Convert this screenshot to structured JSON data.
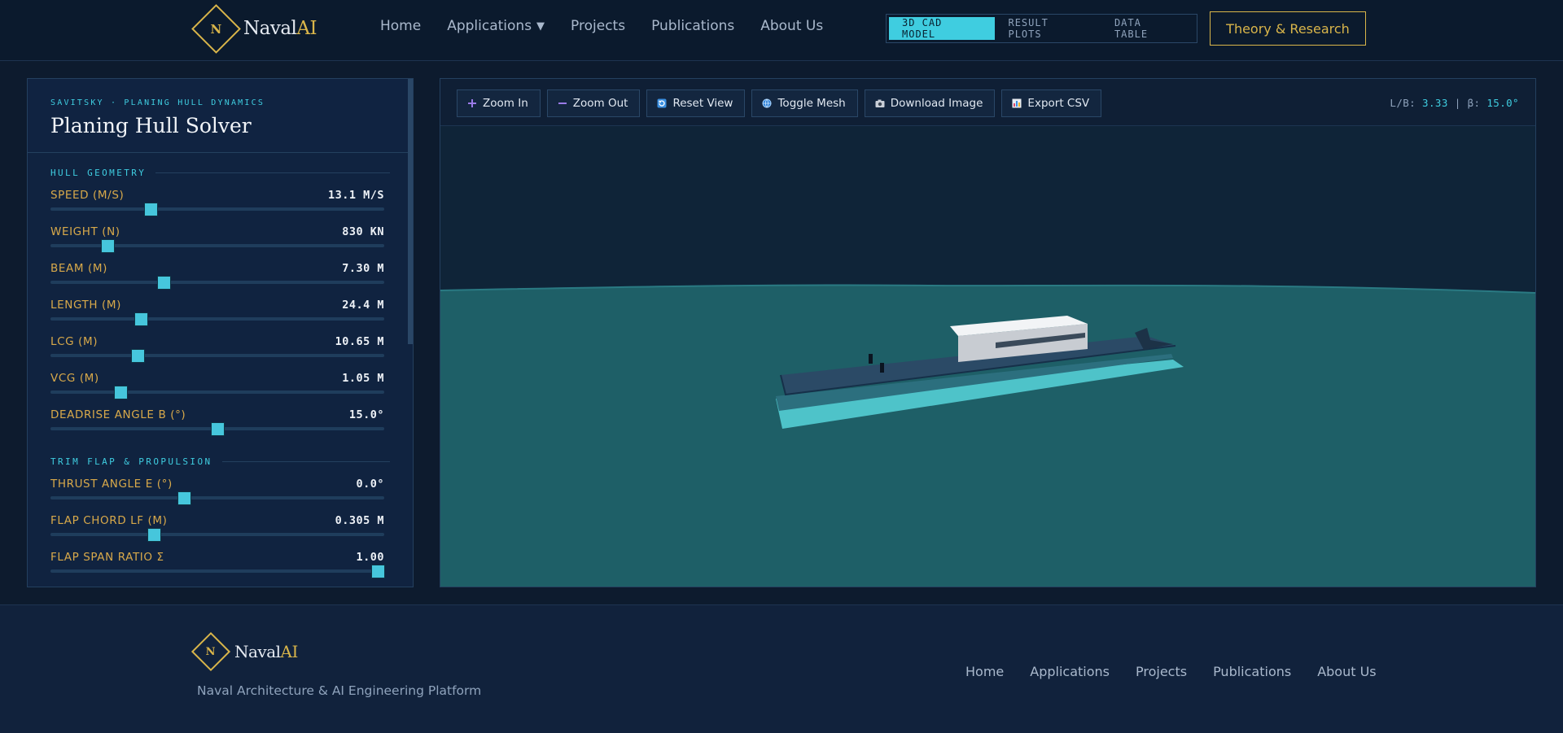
{
  "brand": {
    "initial": "N",
    "name_main": "Naval",
    "name_accent": "AI"
  },
  "nav": {
    "home": "Home",
    "applications": "Applications",
    "applications_caret": "▼",
    "projects": "Projects",
    "publications": "Publications",
    "about": "About Us"
  },
  "view_tabs": [
    {
      "label": "3D CAD MODEL",
      "active": true
    },
    {
      "label": "RESULT PLOTS",
      "active": false
    },
    {
      "label": "DATA TABLE",
      "active": false
    }
  ],
  "theory_button": "Theory & Research",
  "panel": {
    "eyebrow": "SAVITSKY · PLANING HULL DYNAMICS",
    "title": "Planing Hull Solver",
    "sections": [
      {
        "label": "HULL GEOMETRY",
        "sliders": [
          {
            "label": "SPEED (M/S)",
            "value": "13.1 M/S",
            "fraction": 0.3
          },
          {
            "label": "WEIGHT (N)",
            "value": "830 KN",
            "fraction": 0.17
          },
          {
            "label": "BEAM (M)",
            "value": "7.30 M",
            "fraction": 0.34
          },
          {
            "label": "LENGTH (M)",
            "value": "24.4 M",
            "fraction": 0.27
          },
          {
            "label": "LCG (M)",
            "value": "10.65 M",
            "fraction": 0.26
          },
          {
            "label": "VCG (M)",
            "value": "1.05 M",
            "fraction": 0.21
          },
          {
            "label": "DEADRISE ANGLE Β (°)",
            "value": "15.0°",
            "fraction": 0.5
          }
        ]
      },
      {
        "label": "TRIM FLAP & PROPULSION",
        "sliders": [
          {
            "label": "THRUST ANGLE Ε (°)",
            "value": "0.0°",
            "fraction": 0.4
          },
          {
            "label": "FLAP CHORD LF (M)",
            "value": "0.305 M",
            "fraction": 0.31
          },
          {
            "label": "FLAP SPAN RATIO Σ",
            "value": "1.00",
            "fraction": 0.98
          }
        ]
      }
    ]
  },
  "toolbar": {
    "zoom_in": "Zoom In",
    "zoom_out": "Zoom Out",
    "reset_view": "Reset View",
    "toggle_mesh": "Toggle Mesh",
    "download_image": "Download Image",
    "export_csv": "Export CSV"
  },
  "readout": {
    "lb_label": "L/B:",
    "lb_value": "3.33",
    "sep": "|",
    "beta_label": "β:",
    "beta_value": "15.0°"
  },
  "footer": {
    "tagline": "Naval Architecture & AI Engineering Platform",
    "nav": [
      "Home",
      "Applications",
      "Projects",
      "Publications",
      "About Us"
    ]
  },
  "colors": {
    "accent": "#3fcde0",
    "gold": "#d9b54a",
    "slider_label": "#d8a94a",
    "sky": "#0f2438",
    "water": "#1e5f67"
  },
  "icons": {
    "zoom_in": "plus-icon",
    "zoom_out": "minus-icon",
    "reset_view": "reset-icon",
    "toggle_mesh": "globe-icon",
    "download_image": "camera-icon",
    "export_csv": "chart-icon"
  }
}
